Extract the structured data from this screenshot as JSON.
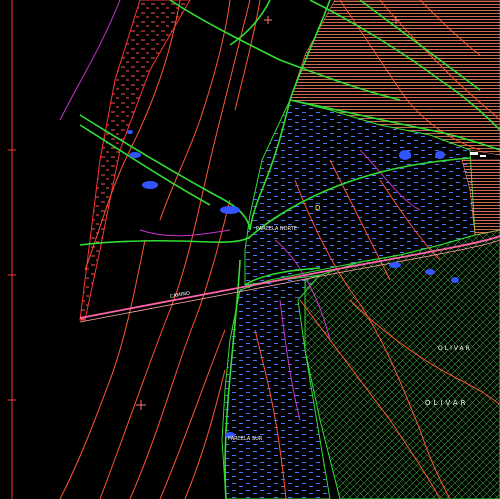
{
  "map": {
    "background": "#000000",
    "colors": {
      "road": "#33dd33",
      "contour": "#ff5533",
      "contour_alt": "#cc33cc",
      "water_hatch": "#4477ff",
      "farm_hatch": "#ff8866",
      "orchard_hatch": "#33cc33",
      "pipe": "#ff66aa",
      "frame": "#ff3333",
      "crosshair": "#ff7777"
    },
    "labels": {
      "parcel_north": "PARCELA NORTE",
      "parcel_south": "PARCELA SUR",
      "road_name": "CAMINO",
      "zone_a": "OLIVAR",
      "zone_b": "OLIVAR"
    },
    "marker_text": "D"
  }
}
